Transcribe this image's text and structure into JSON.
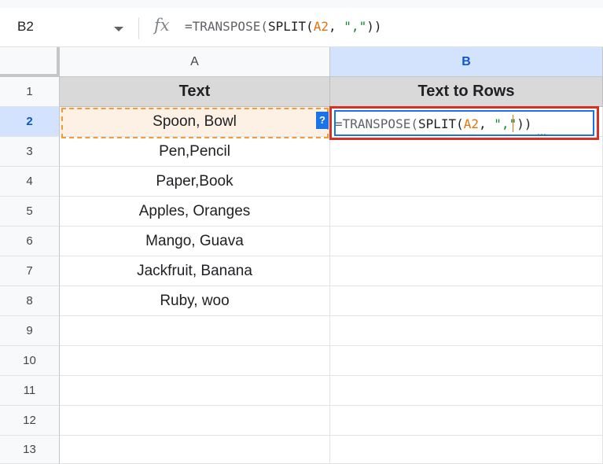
{
  "formula_bar": {
    "name_box": "B2",
    "fx_label": "fx",
    "formula_parts": {
      "p1": "=TRANSPOSE(",
      "p2": "SPLIT(",
      "p3": "A2",
      "p4": ", ",
      "p5": "\",\"",
      "p6": "))"
    }
  },
  "columns": [
    {
      "label": "A",
      "selected": false
    },
    {
      "label": "B",
      "selected": true
    }
  ],
  "rows": [
    "1",
    "2",
    "3",
    "4",
    "5",
    "6",
    "7",
    "8",
    "9",
    "10",
    "11",
    "12",
    "13"
  ],
  "selected_row": "2",
  "cells": {
    "A1": "Text",
    "B1": "Text to Rows",
    "A2": "Spoon, Bowl",
    "A3": "Pen,Pencil",
    "A4": "Paper,Book",
    "A5": "Apples, Oranges",
    "A6": "Mango, Guava",
    "A7": "Jackfruit, Banana",
    "A8": "Ruby, woo"
  },
  "edit_badge": "?",
  "colors": {
    "accent_blue": "#1a73e8",
    "ref_orange": "#e8710a",
    "string_green": "#188038",
    "highlight_red": "#d93025"
  }
}
